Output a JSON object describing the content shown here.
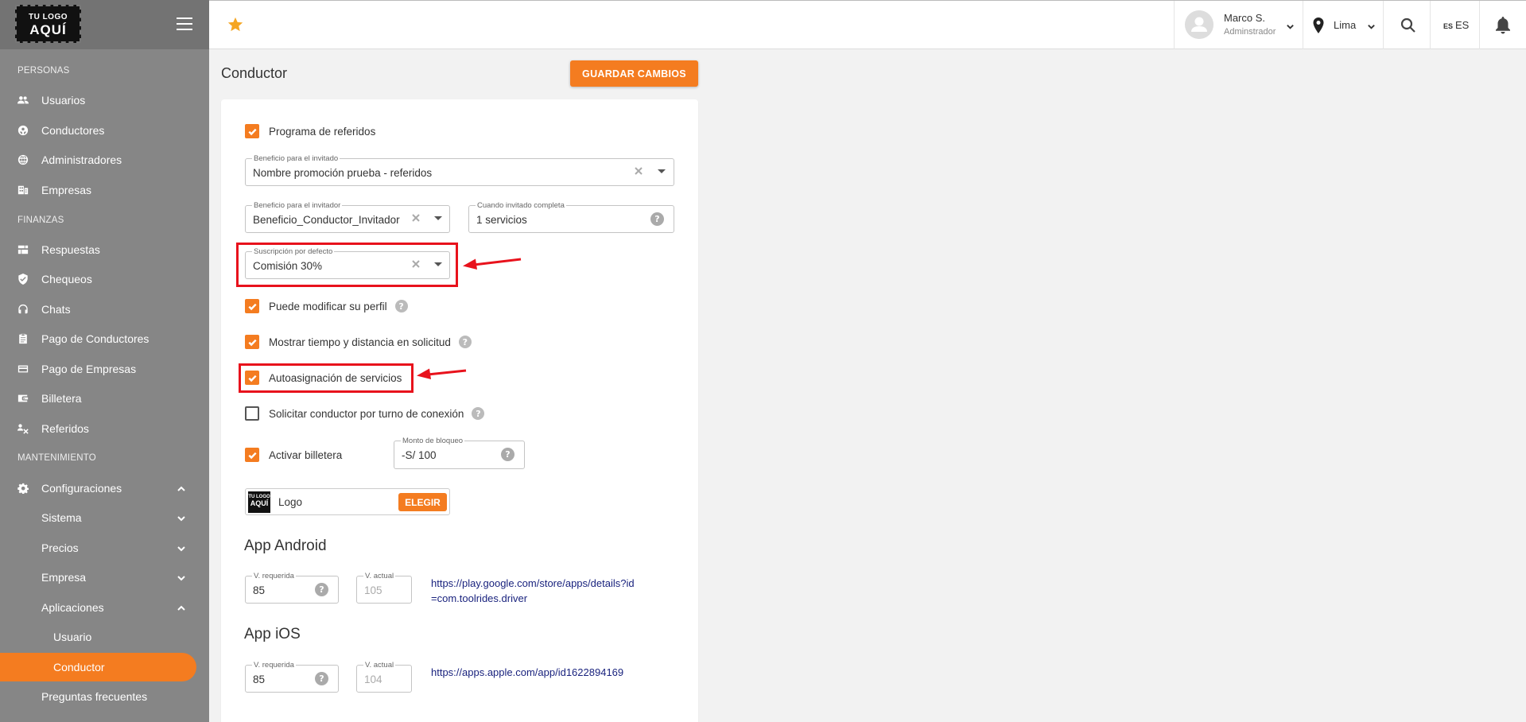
{
  "logo": {
    "line1": "TU LOGO",
    "line2": "AQUÍ"
  },
  "sidebar": {
    "sections": [
      "PERSONAS",
      "FINANZAS",
      "MANTENIMIENTO"
    ],
    "personas": [
      "Usuarios",
      "Conductores",
      "Administradores",
      "Empresas"
    ],
    "finanzas": [
      "Respuestas",
      "Chequeos",
      "Chats",
      "Pago de Conductores",
      "Pago de Empresas",
      "Billetera",
      "Referidos"
    ],
    "mantenimiento": {
      "configuraciones": "Configuraciones",
      "sistema": "Sistema",
      "precios": "Precios",
      "empresa": "Empresa",
      "aplicaciones": "Aplicaciones",
      "usuario": "Usuario",
      "conductor": "Conductor",
      "preguntas": "Preguntas frecuentes"
    }
  },
  "topbar": {
    "user_name": "Marco S.",
    "user_role": "Adminstrador",
    "city": "Lima",
    "lang_code": "ES",
    "lang_label": "ES"
  },
  "main": {
    "title": "Conductor",
    "save_label": "GUARDAR CAMBIOS",
    "programa_referidos": "Programa de referidos",
    "beneficio_invitado": {
      "label": "Beneficio para el invitado",
      "value": "Nombre promoción prueba - referidos"
    },
    "beneficio_invitador": {
      "label": "Beneficio para el invitador",
      "value": "Beneficio_Conductor_Invitador"
    },
    "cuando_completa": {
      "label": "Cuando invitado completa",
      "value": "1 servicios"
    },
    "suscripcion": {
      "label": "Suscripción por defecto",
      "value": "Comisión 30%"
    },
    "puede_modificar": "Puede modificar su perfil",
    "mostrar_tiempo": "Mostrar tiempo y distancia en solicitud",
    "autoasignacion": "Autoasignación de servicios",
    "solicitar_turno": "Solicitar conductor por turno de conexión",
    "activar_billetera": "Activar billetera",
    "monto_bloqueo": {
      "label": "Monto de bloqueo",
      "value": "-S/ 100"
    },
    "logo_label": "Logo",
    "elegir_label": "ELEGIR",
    "help_glyph": "?",
    "android": {
      "title": "App Android",
      "req_label": "V. requerida",
      "req_value": "85",
      "act_label": "V. actual",
      "act_value": "105",
      "link": "https://play.google.com/store/apps/details?id=com.toolrides.driver"
    },
    "ios": {
      "title": "App iOS",
      "req_label": "V. requerida",
      "req_value": "85",
      "act_label": "V. actual",
      "act_value": "104",
      "link": "https://apps.apple.com/app/id1622894169"
    }
  },
  "colors": {
    "accent": "#f47c20",
    "sidebar": "#868686",
    "highlight": "#e8121c",
    "link": "#1a237e"
  }
}
